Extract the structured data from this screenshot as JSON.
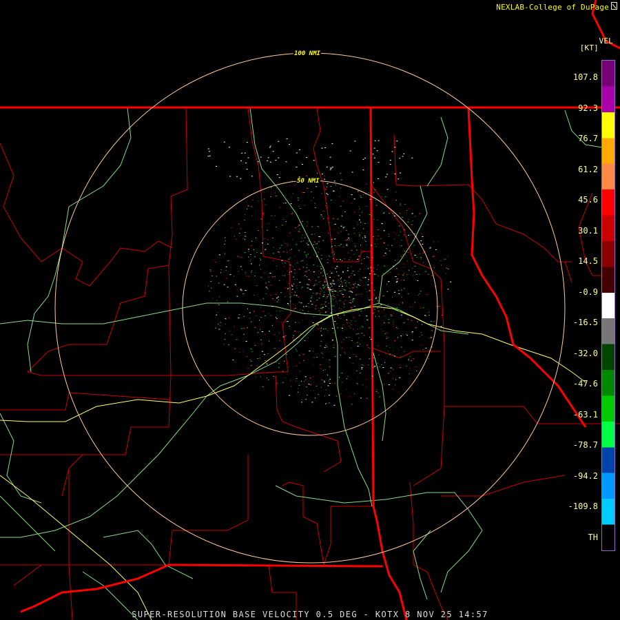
{
  "header": {
    "credit": "NEXLAB-College of DuPage",
    "product": "VEL",
    "units": "[KT]"
  },
  "range_rings": {
    "outer_label": "100 NMI",
    "inner_label": "50 NMI"
  },
  "color_scale": {
    "labels": [
      "107.8",
      "92.3",
      "76.7",
      "61.2",
      "45.6",
      "30.1",
      "14.5",
      "-0.9",
      "-16.5",
      "-32.0",
      "-47.6",
      "-63.1",
      "-78.7",
      "-94.2",
      "-109.8",
      "TH"
    ],
    "stops": [
      {
        "color": "#770077"
      },
      {
        "color": "#aa00aa"
      },
      {
        "color": "#ffff00"
      },
      {
        "color": "#ffaa00"
      },
      {
        "color": "#ff8844"
      },
      {
        "color": "#ff0000"
      },
      {
        "color": "#cc0000"
      },
      {
        "color": "#880000"
      },
      {
        "color": "#440000"
      },
      {
        "color": "#ffffff"
      },
      {
        "color": "#777777"
      },
      {
        "color": "#004400"
      },
      {
        "color": "#008800"
      },
      {
        "color": "#00cc00"
      },
      {
        "color": "#00ff44"
      },
      {
        "color": "#0044aa"
      },
      {
        "color": "#0099ff"
      },
      {
        "color": "#00ccff"
      },
      {
        "color": "#000000"
      }
    ]
  },
  "footer": {
    "caption": "SUPER-RESOLUTION BASE VELOCITY 0.5 DEG - KOTX 8 NOV 25 14:57"
  },
  "colors": {
    "state_border": "#ff0000",
    "county_line": "#cc0000",
    "highway_interstate": "#ffff66",
    "highway_other": "#88dd88",
    "range_ring": "#ffcc99"
  }
}
